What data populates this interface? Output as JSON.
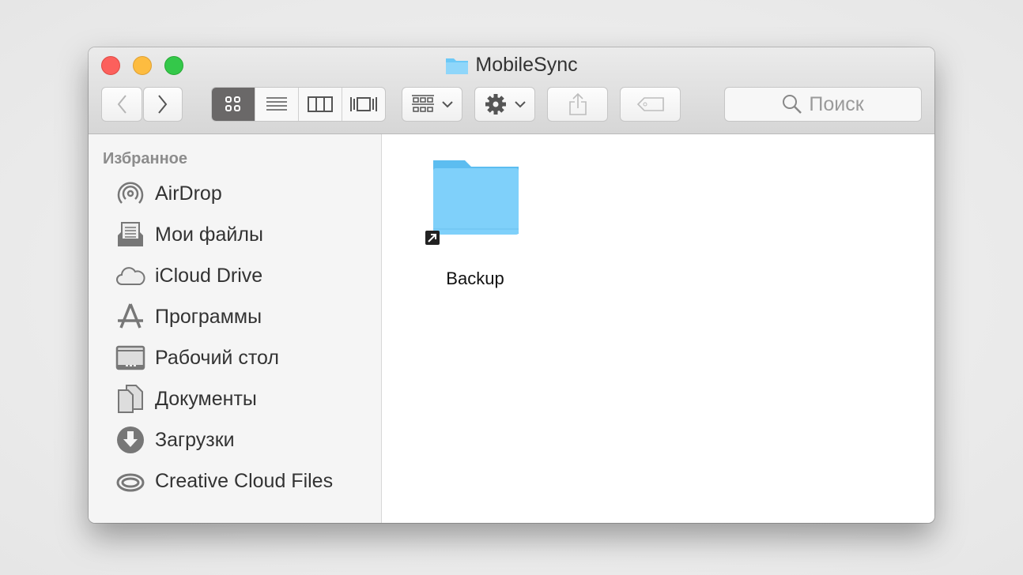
{
  "window": {
    "title": "MobileSync"
  },
  "toolbar": {
    "back": "back",
    "forward": "forward",
    "views": [
      "icon-view",
      "list-view",
      "column-view",
      "cover-flow-view"
    ],
    "active_view": "icon-view",
    "search_placeholder": "Поиск"
  },
  "sidebar": {
    "header": "Избранное",
    "items": [
      {
        "label": "AirDrop",
        "icon": "airdrop-icon"
      },
      {
        "label": "Мои файлы",
        "icon": "all-files-icon"
      },
      {
        "label": "iCloud Drive",
        "icon": "cloud-icon"
      },
      {
        "label": "Программы",
        "icon": "applications-icon"
      },
      {
        "label": "Рабочий стол",
        "icon": "desktop-icon"
      },
      {
        "label": "Документы",
        "icon": "documents-icon"
      },
      {
        "label": "Загрузки",
        "icon": "downloads-icon"
      },
      {
        "label": "Creative Cloud Files",
        "icon": "creative-cloud-icon"
      }
    ]
  },
  "content": {
    "files": [
      {
        "name": "Backup",
        "type": "folder-alias"
      }
    ]
  },
  "colors": {
    "close": "#fc605c",
    "minimize": "#fdbc40",
    "zoom": "#34c84a",
    "folder": "#6cc9f7"
  }
}
